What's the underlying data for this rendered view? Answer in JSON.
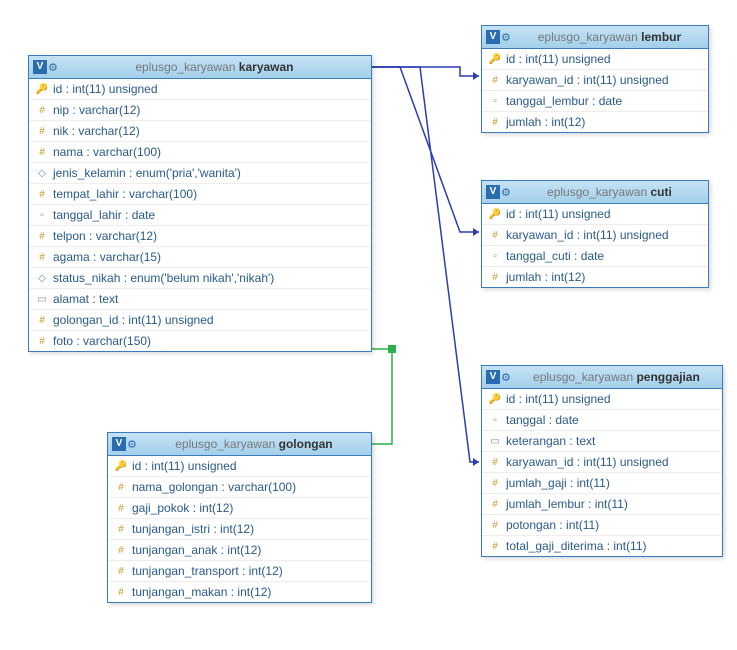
{
  "tables": {
    "karyawan": {
      "schema": "eplusgo_karyawan",
      "name": "karyawan",
      "cols": [
        {
          "icon": "key",
          "t": "id : int(11) unsigned"
        },
        {
          "icon": "hash",
          "t": "nip : varchar(12)"
        },
        {
          "icon": "hash",
          "t": "nik : varchar(12)"
        },
        {
          "icon": "hash",
          "t": "nama : varchar(100)"
        },
        {
          "icon": "diamond",
          "t": "jenis_kelamin : enum('pria','wanita')"
        },
        {
          "icon": "hash",
          "t": "tempat_lahir : varchar(100)"
        },
        {
          "icon": "date",
          "t": "tanggal_lahir : date"
        },
        {
          "icon": "hash",
          "t": "telpon : varchar(12)"
        },
        {
          "icon": "hash",
          "t": "agama : varchar(15)"
        },
        {
          "icon": "diamond",
          "t": "status_nikah : enum('belum nikah','nikah')"
        },
        {
          "icon": "text",
          "t": "alamat : text"
        },
        {
          "icon": "hash",
          "t": "golongan_id : int(11) unsigned"
        },
        {
          "icon": "hash",
          "t": "foto : varchar(150)"
        }
      ]
    },
    "lembur": {
      "schema": "eplusgo_karyawan",
      "name": "lembur",
      "cols": [
        {
          "icon": "key",
          "t": "id : int(11) unsigned"
        },
        {
          "icon": "hash",
          "t": "karyawan_id : int(11) unsigned"
        },
        {
          "icon": "date",
          "t": "tanggal_lembur : date"
        },
        {
          "icon": "hash",
          "t": "jumlah : int(12)"
        }
      ]
    },
    "cuti": {
      "schema": "eplusgo_karyawan",
      "name": "cuti",
      "cols": [
        {
          "icon": "key",
          "t": "id : int(11) unsigned"
        },
        {
          "icon": "hash",
          "t": "karyawan_id : int(11) unsigned"
        },
        {
          "icon": "date",
          "t": "tanggal_cuti : date"
        },
        {
          "icon": "hash",
          "t": "jumlah : int(12)"
        }
      ]
    },
    "golongan": {
      "schema": "eplusgo_karyawan",
      "name": "golongan",
      "cols": [
        {
          "icon": "key",
          "t": "id : int(11) unsigned"
        },
        {
          "icon": "hash",
          "t": "nama_golongan : varchar(100)"
        },
        {
          "icon": "hash",
          "t": "gaji_pokok : int(12)"
        },
        {
          "icon": "hash",
          "t": "tunjangan_istri : int(12)"
        },
        {
          "icon": "hash",
          "t": "tunjangan_anak : int(12)"
        },
        {
          "icon": "hash",
          "t": "tunjangan_transport : int(12)"
        },
        {
          "icon": "hash",
          "t": "tunjangan_makan : int(12)"
        }
      ]
    },
    "penggajian": {
      "schema": "eplusgo_karyawan",
      "name": "penggajian",
      "cols": [
        {
          "icon": "key",
          "t": "id : int(11) unsigned"
        },
        {
          "icon": "date",
          "t": "tanggal : date"
        },
        {
          "icon": "text",
          "t": "keterangan : text"
        },
        {
          "icon": "hash",
          "t": "karyawan_id : int(11) unsigned"
        },
        {
          "icon": "hash",
          "t": "jumlah_gaji : int(11)"
        },
        {
          "icon": "hash",
          "t": "jumlah_lembur : int(11)"
        },
        {
          "icon": "hash",
          "t": "potongan : int(11)"
        },
        {
          "icon": "hash",
          "t": "total_gaji_diterima : int(11)"
        }
      ]
    }
  },
  "iconmap": {
    "key": "🔑",
    "hash": "#",
    "diamond": "◇",
    "text": "▭",
    "date": "▫"
  }
}
